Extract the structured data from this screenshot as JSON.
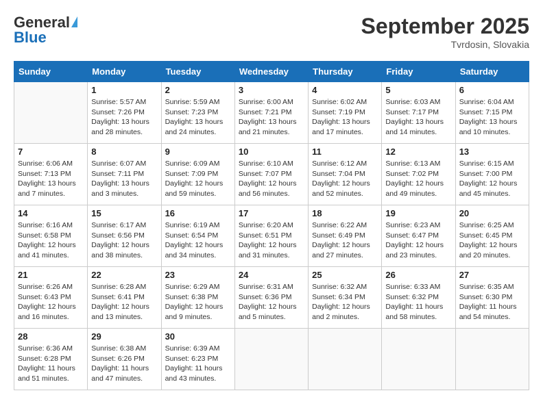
{
  "header": {
    "logo_general": "General",
    "logo_blue": "Blue",
    "month": "September 2025",
    "location": "Tvrdosin, Slovakia"
  },
  "days_of_week": [
    "Sunday",
    "Monday",
    "Tuesday",
    "Wednesday",
    "Thursday",
    "Friday",
    "Saturday"
  ],
  "weeks": [
    [
      {
        "day": "",
        "sunrise": "",
        "sunset": "",
        "daylight": ""
      },
      {
        "day": "1",
        "sunrise": "Sunrise: 5:57 AM",
        "sunset": "Sunset: 7:26 PM",
        "daylight": "Daylight: 13 hours and 28 minutes."
      },
      {
        "day": "2",
        "sunrise": "Sunrise: 5:59 AM",
        "sunset": "Sunset: 7:23 PM",
        "daylight": "Daylight: 13 hours and 24 minutes."
      },
      {
        "day": "3",
        "sunrise": "Sunrise: 6:00 AM",
        "sunset": "Sunset: 7:21 PM",
        "daylight": "Daylight: 13 hours and 21 minutes."
      },
      {
        "day": "4",
        "sunrise": "Sunrise: 6:02 AM",
        "sunset": "Sunset: 7:19 PM",
        "daylight": "Daylight: 13 hours and 17 minutes."
      },
      {
        "day": "5",
        "sunrise": "Sunrise: 6:03 AM",
        "sunset": "Sunset: 7:17 PM",
        "daylight": "Daylight: 13 hours and 14 minutes."
      },
      {
        "day": "6",
        "sunrise": "Sunrise: 6:04 AM",
        "sunset": "Sunset: 7:15 PM",
        "daylight": "Daylight: 13 hours and 10 minutes."
      }
    ],
    [
      {
        "day": "7",
        "sunrise": "Sunrise: 6:06 AM",
        "sunset": "Sunset: 7:13 PM",
        "daylight": "Daylight: 13 hours and 7 minutes."
      },
      {
        "day": "8",
        "sunrise": "Sunrise: 6:07 AM",
        "sunset": "Sunset: 7:11 PM",
        "daylight": "Daylight: 13 hours and 3 minutes."
      },
      {
        "day": "9",
        "sunrise": "Sunrise: 6:09 AM",
        "sunset": "Sunset: 7:09 PM",
        "daylight": "Daylight: 12 hours and 59 minutes."
      },
      {
        "day": "10",
        "sunrise": "Sunrise: 6:10 AM",
        "sunset": "Sunset: 7:07 PM",
        "daylight": "Daylight: 12 hours and 56 minutes."
      },
      {
        "day": "11",
        "sunrise": "Sunrise: 6:12 AM",
        "sunset": "Sunset: 7:04 PM",
        "daylight": "Daylight: 12 hours and 52 minutes."
      },
      {
        "day": "12",
        "sunrise": "Sunrise: 6:13 AM",
        "sunset": "Sunset: 7:02 PM",
        "daylight": "Daylight: 12 hours and 49 minutes."
      },
      {
        "day": "13",
        "sunrise": "Sunrise: 6:15 AM",
        "sunset": "Sunset: 7:00 PM",
        "daylight": "Daylight: 12 hours and 45 minutes."
      }
    ],
    [
      {
        "day": "14",
        "sunrise": "Sunrise: 6:16 AM",
        "sunset": "Sunset: 6:58 PM",
        "daylight": "Daylight: 12 hours and 41 minutes."
      },
      {
        "day": "15",
        "sunrise": "Sunrise: 6:17 AM",
        "sunset": "Sunset: 6:56 PM",
        "daylight": "Daylight: 12 hours and 38 minutes."
      },
      {
        "day": "16",
        "sunrise": "Sunrise: 6:19 AM",
        "sunset": "Sunset: 6:54 PM",
        "daylight": "Daylight: 12 hours and 34 minutes."
      },
      {
        "day": "17",
        "sunrise": "Sunrise: 6:20 AM",
        "sunset": "Sunset: 6:51 PM",
        "daylight": "Daylight: 12 hours and 31 minutes."
      },
      {
        "day": "18",
        "sunrise": "Sunrise: 6:22 AM",
        "sunset": "Sunset: 6:49 PM",
        "daylight": "Daylight: 12 hours and 27 minutes."
      },
      {
        "day": "19",
        "sunrise": "Sunrise: 6:23 AM",
        "sunset": "Sunset: 6:47 PM",
        "daylight": "Daylight: 12 hours and 23 minutes."
      },
      {
        "day": "20",
        "sunrise": "Sunrise: 6:25 AM",
        "sunset": "Sunset: 6:45 PM",
        "daylight": "Daylight: 12 hours and 20 minutes."
      }
    ],
    [
      {
        "day": "21",
        "sunrise": "Sunrise: 6:26 AM",
        "sunset": "Sunset: 6:43 PM",
        "daylight": "Daylight: 12 hours and 16 minutes."
      },
      {
        "day": "22",
        "sunrise": "Sunrise: 6:28 AM",
        "sunset": "Sunset: 6:41 PM",
        "daylight": "Daylight: 12 hours and 13 minutes."
      },
      {
        "day": "23",
        "sunrise": "Sunrise: 6:29 AM",
        "sunset": "Sunset: 6:38 PM",
        "daylight": "Daylight: 12 hours and 9 minutes."
      },
      {
        "day": "24",
        "sunrise": "Sunrise: 6:31 AM",
        "sunset": "Sunset: 6:36 PM",
        "daylight": "Daylight: 12 hours and 5 minutes."
      },
      {
        "day": "25",
        "sunrise": "Sunrise: 6:32 AM",
        "sunset": "Sunset: 6:34 PM",
        "daylight": "Daylight: 12 hours and 2 minutes."
      },
      {
        "day": "26",
        "sunrise": "Sunrise: 6:33 AM",
        "sunset": "Sunset: 6:32 PM",
        "daylight": "Daylight: 11 hours and 58 minutes."
      },
      {
        "day": "27",
        "sunrise": "Sunrise: 6:35 AM",
        "sunset": "Sunset: 6:30 PM",
        "daylight": "Daylight: 11 hours and 54 minutes."
      }
    ],
    [
      {
        "day": "28",
        "sunrise": "Sunrise: 6:36 AM",
        "sunset": "Sunset: 6:28 PM",
        "daylight": "Daylight: 11 hours and 51 minutes."
      },
      {
        "day": "29",
        "sunrise": "Sunrise: 6:38 AM",
        "sunset": "Sunset: 6:26 PM",
        "daylight": "Daylight: 11 hours and 47 minutes."
      },
      {
        "day": "30",
        "sunrise": "Sunrise: 6:39 AM",
        "sunset": "Sunset: 6:23 PM",
        "daylight": "Daylight: 11 hours and 43 minutes."
      },
      {
        "day": "",
        "sunrise": "",
        "sunset": "",
        "daylight": ""
      },
      {
        "day": "",
        "sunrise": "",
        "sunset": "",
        "daylight": ""
      },
      {
        "day": "",
        "sunrise": "",
        "sunset": "",
        "daylight": ""
      },
      {
        "day": "",
        "sunrise": "",
        "sunset": "",
        "daylight": ""
      }
    ]
  ]
}
